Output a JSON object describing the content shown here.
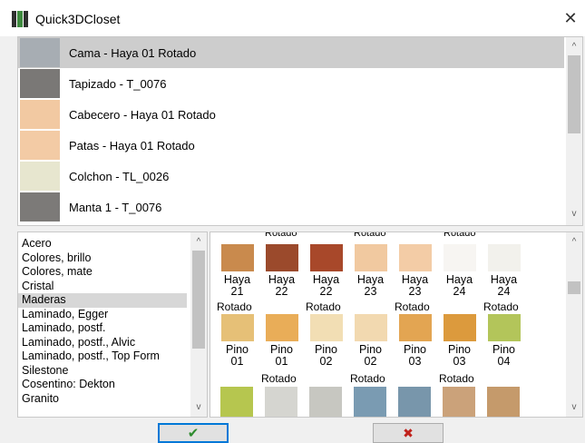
{
  "window": {
    "title": "Quick3DCloset",
    "close_glyph": "✕"
  },
  "top_list": {
    "items": [
      {
        "label": "Cama - Haya 01 Rotado",
        "swatch": "#a7adb3",
        "selected": true
      },
      {
        "label": "Tapizado - T_0076",
        "swatch": "#7a7876",
        "selected": false
      },
      {
        "label": "Cabecero - Haya 01 Rotado",
        "swatch": "#f2c9a2",
        "selected": false
      },
      {
        "label": "Patas - Haya 01 Rotado",
        "swatch": "#f3cba5",
        "selected": false
      },
      {
        "label": "Colchon - TL_0026",
        "swatch": "#e7e6cf",
        "selected": false
      },
      {
        "label": "Manta 1 - T_0076",
        "swatch": "#7c7a78",
        "selected": false
      }
    ]
  },
  "categories": {
    "items": [
      "Acero",
      "Colores, brillo",
      "Colores, mate",
      "Cristal",
      "Maderas",
      "Laminado, Egger",
      "Laminado, postf.",
      "Laminado, postf., Alvic",
      "Laminado, postf., Top Form",
      "Silestone",
      "Cosentino: Dekton",
      "Granito"
    ],
    "selected_index": 4
  },
  "materials": {
    "cut_labels": [
      "Rotado",
      "Rotado",
      "Rotado"
    ],
    "row1": [
      {
        "l1": "Haya",
        "l2": "21",
        "color": "#c98a4d"
      },
      {
        "l1": "Haya",
        "l2": "22",
        "color": "#9b4a2c"
      },
      {
        "l1": "Haya",
        "l2": "22",
        "color": "#a8482a"
      },
      {
        "l1": "Haya",
        "l2": "23",
        "color": "#f1c9a0"
      },
      {
        "l1": "Haya",
        "l2": "23",
        "color": "#f3cca6"
      },
      {
        "l1": "Haya",
        "l2": "24",
        "color": "#f7f5f2"
      },
      {
        "l1": "Haya",
        "l2": "24",
        "color": "#f2f1ec"
      }
    ],
    "row1_sublabels": [
      "Rotado",
      "Rotado",
      "Rotado",
      "Rotado"
    ],
    "row2": [
      {
        "l1": "Pino",
        "l2": "01",
        "color": "#e6c077"
      },
      {
        "l1": "Pino",
        "l2": "01",
        "color": "#e9ad58"
      },
      {
        "l1": "Pino",
        "l2": "02",
        "color": "#f2deb4"
      },
      {
        "l1": "Pino",
        "l2": "02",
        "color": "#f2d9b0"
      },
      {
        "l1": "Pino",
        "l2": "03",
        "color": "#e3a552"
      },
      {
        "l1": "Pino",
        "l2": "03",
        "color": "#dc9a3d"
      },
      {
        "l1": "Pino",
        "l2": "04",
        "color": "#b3c55a"
      }
    ],
    "row2_sublabels": [
      "Rotado",
      "Rotado",
      "Rotado"
    ],
    "row3_colors": [
      "#b6c64f",
      "#d5d5d0",
      "#c7c7c1",
      "#7a9bb2",
      "#7896ab",
      "#cba27a",
      "#c59a6b"
    ]
  },
  "buttons": {
    "ok_glyph": "✔",
    "cancel_glyph": "✖"
  },
  "scroll": {
    "up": "^",
    "down": "v"
  },
  "colors": {
    "accent": "#0078d7",
    "ok_check": "#2e8b2e",
    "cancel_x": "#c0211b"
  }
}
